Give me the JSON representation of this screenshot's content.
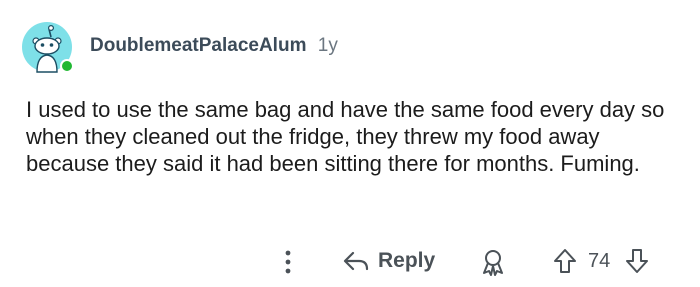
{
  "comment": {
    "username": "DoublemeatPalaceAlum",
    "age": "1y",
    "body": "I used to use the same bag and have the same food every day so when they cleaned out the fridge, they threw my food away because they said it had been sitting there for months. Fuming.",
    "avatar_icon": "reddit-snoo-icon",
    "online_status_color": "#20b832",
    "avatar_bg_color": "#7ee0e8"
  },
  "actions": {
    "more_icon": "more-vertical-icon",
    "reply_icon": "reply-arrow-icon",
    "reply_label": "Reply",
    "award_icon": "award-icon",
    "upvote_icon": "upvote-arrow-icon",
    "vote_count": "74",
    "downvote_icon": "downvote-arrow-icon"
  }
}
